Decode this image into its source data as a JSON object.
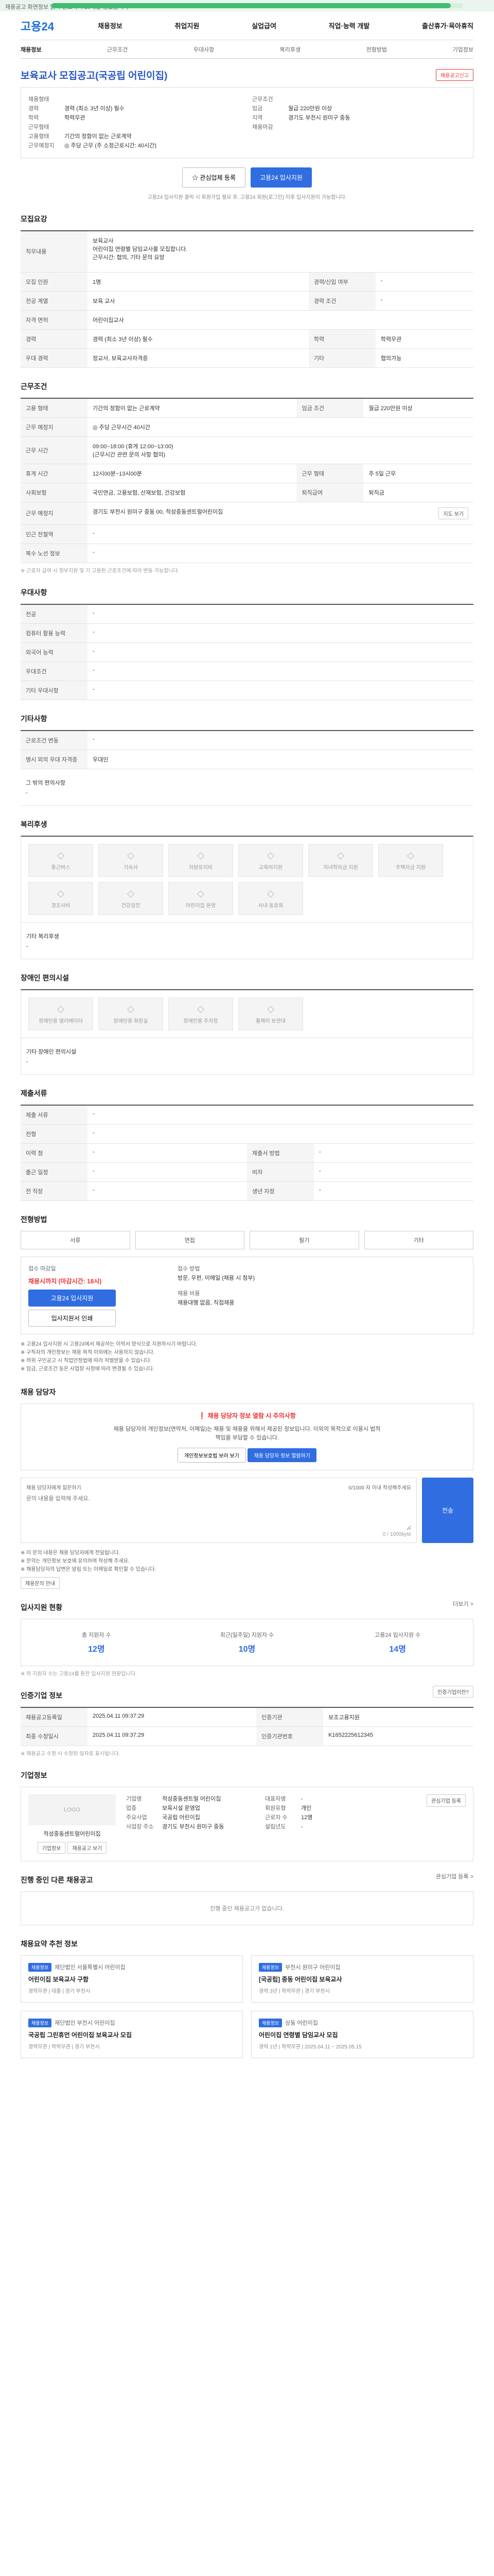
{
  "topbar": {
    "text": "채용공고 화면정보 읽기 완료까지 19개월 남았습니다"
  },
  "progress": {
    "percent": 97
  },
  "header": {
    "logo": "고용24",
    "menu": [
      "채용정보",
      "취업지원",
      "실업급여",
      "직업·능력 개발",
      "출산휴가·육아휴직"
    ]
  },
  "subtabs": [
    "채용정보",
    "근무조건",
    "우대사항",
    "복리후생",
    "전형방법",
    "기업정보"
  ],
  "job": {
    "title": "보육교사 모집공고(국공립 어린이집)",
    "report": "채용공고신고",
    "left": [
      {
        "k": "채용형태",
        "v": ""
      },
      {
        "k": "경력",
        "v": "경력 (최소 3년 이상) 필수"
      },
      {
        "k": "학력",
        "v": "학력무관"
      },
      {
        "k": "근무형태",
        "v": ""
      },
      {
        "k": "고용형태",
        "v": "기간의 정함이 없는 근로계약"
      },
      {
        "k": "근무예정지",
        "v": "◎ 주당 근무 (주 소정근로시간: 40시간)"
      }
    ],
    "right": [
      {
        "k": "근무조건",
        "v": ""
      },
      {
        "k": "임금",
        "v": "월급 220만원 이상"
      },
      {
        "k": "지역",
        "v": "경기도 부천시 원미구 중동"
      },
      {
        "k": "채용마감",
        "v": ""
      }
    ],
    "interest_btn": "관심업체 등록",
    "apply_btn": "고용24 입사지원",
    "notice": "고용24 입사지원 클릭 시 회원가입 필요 후, 고용24 회원(로그인) 이후 입사지원이 가능합니다."
  },
  "sections": {
    "recruit": "모집요강",
    "work": "근무조건",
    "pref": "우대사항",
    "etc": "기타사항",
    "welfare": "복리후생",
    "disab": "장애인 편의시설",
    "doc": "제출서류",
    "method": "전형방법",
    "contact": "채용 담당자",
    "stats": "입사지원 현황",
    "notice": "인증기업 정보",
    "company": "기업정보",
    "others": "진행 중인 다른 채용공고",
    "reco": "채용요약 추천 정보"
  },
  "recruit": {
    "duty_label": "직무내용",
    "duty": "보육교사\n어린이집 연령별 담임교사를 모집합니다.\n근무시간: 협의, 기타 문의 요망",
    "rows": [
      [
        "모집 인원",
        "1명",
        "경력/신입 여부",
        "-"
      ],
      [
        "전공 계열",
        "보육 교사",
        "경력 조건",
        "-"
      ],
      [
        "자격 면허",
        "어린이집교사",
        null,
        null
      ],
      [
        "경력",
        "경력 (최소 3년 이상) 필수",
        "학력",
        "학력무관"
      ],
      [
        "우대 경력",
        "정교사, 보육교사자격증",
        "기타",
        "협의가능"
      ]
    ]
  },
  "work": {
    "rows": [
      [
        "고용 형태",
        "기간의 정함이 없는 근로계약",
        "임금 조건",
        "월급 220만원 이상"
      ],
      [
        "근무 예정지",
        "◎ 주당 근무시간 40시간",
        null,
        null
      ],
      [
        "근무 시간",
        "09:00~18:00 (휴게 12:00~13:00)\n(근무시간 관련 문의 사항 협의)",
        null,
        null
      ],
      [
        "휴게 시간",
        "12시00분~13시00분",
        "근무 형태",
        "주 5일 근무"
      ],
      [
        "사회보험",
        "국민연금, 고용보험, 산재보험, 건강보험",
        "퇴직급여",
        "퇴직금"
      ],
      [
        "근무 예정지",
        "경기도 부천시 원미구 중동 00, 적성중동센트럴어린이집",
        "map",
        "지도 보기"
      ],
      [
        "인근 전철역",
        "-",
        null,
        null
      ],
      [
        "복수 노선 정보",
        "-",
        null,
        null
      ]
    ],
    "note": "※ 근로자 급여 시 정부지원 및 기 고용된 근로조건에 따라 변동 가능합니다."
  },
  "pref": {
    "rows": [
      [
        "전공",
        "-"
      ],
      [
        "컴퓨터 활용 능력",
        "-"
      ],
      [
        "외국어 능력",
        "-"
      ],
      [
        "우대조건",
        "-"
      ],
      [
        "기타 우대사항",
        "-"
      ]
    ]
  },
  "etc": {
    "rows": [
      [
        "근로조건 변동",
        "-"
      ],
      [
        "명시 외의 우대 자격증",
        "우대인"
      ]
    ],
    "extra_label": "그 밖의 편의사항",
    "extra": "-"
  },
  "welfare": {
    "items": [
      "통근버스",
      "기숙사",
      "차량유지비",
      "교육비지원",
      "자녀학자금 지원",
      "주택자금 지원",
      "경조사비",
      "건강검진",
      "어린이집 운영",
      "사내 동호회"
    ],
    "other_label": "기타 복리후생",
    "other": "-"
  },
  "disab": {
    "items": [
      "장애인용 엘리베이터",
      "장애인용 화장실",
      "장애인용 주차장",
      "휠체어 보관대"
    ],
    "other_label": "기타 장애인 편의시설",
    "other": "-"
  },
  "doc": {
    "rows": [
      [
        "제출 서류",
        "-",
        null,
        null
      ],
      [
        "전형",
        "-",
        null,
        null
      ],
      [
        "이력 첨",
        "-",
        "제출서 방법",
        "-"
      ],
      [
        "출근 일정",
        "-",
        "비자",
        "-"
      ],
      [
        "전 직장",
        "-",
        "생년 자정",
        "-"
      ]
    ]
  },
  "method": {
    "steps": [
      "서류",
      "면접",
      "필기",
      "기타"
    ],
    "apply_label": "접수 마감일",
    "deadline_label": "채용시까지 (마감시간: 18시)",
    "apply_btn": "고용24 입사지원",
    "print_btn": "입사지원서 인쇄",
    "method_label": "접수 방법",
    "methods": "방문, 우편, 이메일 (채용 시 첨부)",
    "type_label": "채용 비용",
    "type": "채용대행 없음, 직접채용",
    "bullets": [
      "※ 고용24 입사지원 시 고용24에서 제공하는 이력서 양식으로 지원하시기 바랍니다.",
      "※ 구직자의 개인정보는 채용 목적 이외에는 사용하지 않습니다.",
      "※ 허위 구인공고 시 직업안정법에 따라 처벌받을 수 있습니다.",
      "※ 임금, 근로조건 등은 사업장 사정에 따라 변경될 수 있습니다."
    ]
  },
  "contact": {
    "warn": "채용 담당자 정보 열람 시 주의사항",
    "desc": "채용 담당자의 개인정보(연락처, 이메일)는 채용 및 채용을 위해서 제공된 정보입니다. 이외의 목적으로 이용시 법적 책임을 부담할 수 있습니다.",
    "btn1": "개인정보보호법 보러 보기",
    "btn2": "채용 담당자 정보 열람하기",
    "form_label": "채용 담당자에게 질문하기",
    "form_note": "0/1000 자 이내 작성해주세요",
    "placeholder": "문의 내용을 입력해 주세요.",
    "count": "0 / 1000byte",
    "submit": "전송",
    "bullets": [
      "※ 이 문의 내용은 채용 담당자에게 전달됩니다.",
      "※ 문의는 개인정보 보호에 유의하여 작성해 주세요.",
      "※ 채용담당자의 답변은 알림 또는 이메일로 확인할 수 있습니다."
    ],
    "guide": "채용문의 안내"
  },
  "stats": {
    "more": "더보기 >",
    "items": [
      {
        "label": "총 지원자 수",
        "value": "12명"
      },
      {
        "label": "최근(일주일) 지원자 수",
        "value": "10명"
      },
      {
        "label": "고용24 입사지원 수",
        "value": "14명"
      }
    ],
    "note": "※ 위 지원자 수는 고용24를 통한 입사지원 현황입니다."
  },
  "cert": {
    "more": "인증기업이란?",
    "rows": [
      [
        "채용공고등록일",
        "2025.04.11 09:37:29",
        "인증기관",
        "보조고용지원"
      ],
      [
        "최종 수정일시",
        "2025.04.11 09:37:29",
        "인증기관번호",
        "K1652225612345"
      ]
    ],
    "print_btn": "인쇄 보기",
    "note": "※ 채용공고 수정 시 수정된 일자로 표시됩니다."
  },
  "company": {
    "logo": "LOGO",
    "name": "적성중동센트럴어린이집",
    "rows": [
      [
        "기업명",
        "적성중동센트럴 어린이집",
        "대표자명",
        "-"
      ],
      [
        "업종",
        "보육시설 운영업",
        "회원유형",
        "개인"
      ],
      [
        "주요사업",
        "국공립 어린이집",
        "근로자 수",
        "12명"
      ],
      [
        "사업장 주소",
        "경기도 부천시 원미구 중동",
        "설립년도",
        "-"
      ]
    ],
    "btn1": "기업정보",
    "btn2": "채용공고 보기",
    "btn3": "관심기업 등록"
  },
  "others": {
    "empty": "진행 중인 채용공고가 없습니다.",
    "more": "관심기업 등록 >"
  },
  "reco": {
    "cards": [
      {
        "badge": "채용정보",
        "org": "재단법인 서울특별시 어린이집",
        "title": "어린이집 보육교사 구함",
        "meta": "경력무관 | 대졸 | 경기 부천시"
      },
      {
        "badge": "채용정보",
        "org": "부천시 원미구 어린이집",
        "title": "[국공립] 중동 어린이집 보육교사",
        "meta": "경력 3년 | 학력무관 | 경기 부천시"
      },
      {
        "badge": "채용정보",
        "org": "재단법인 부천시 어린이집",
        "title": "국공립 그린휴먼 어린이집 보육교사 모집",
        "meta": "경력무관 | 학력무관 | 경기 부천시"
      },
      {
        "badge": "채용정보",
        "org": "상동 어린이집",
        "title": "어린이집 연령별 담임교사 모집",
        "meta": "경력 1년 | 학력무관 | 2025.04.11 ~ 2025.05.15"
      }
    ]
  }
}
